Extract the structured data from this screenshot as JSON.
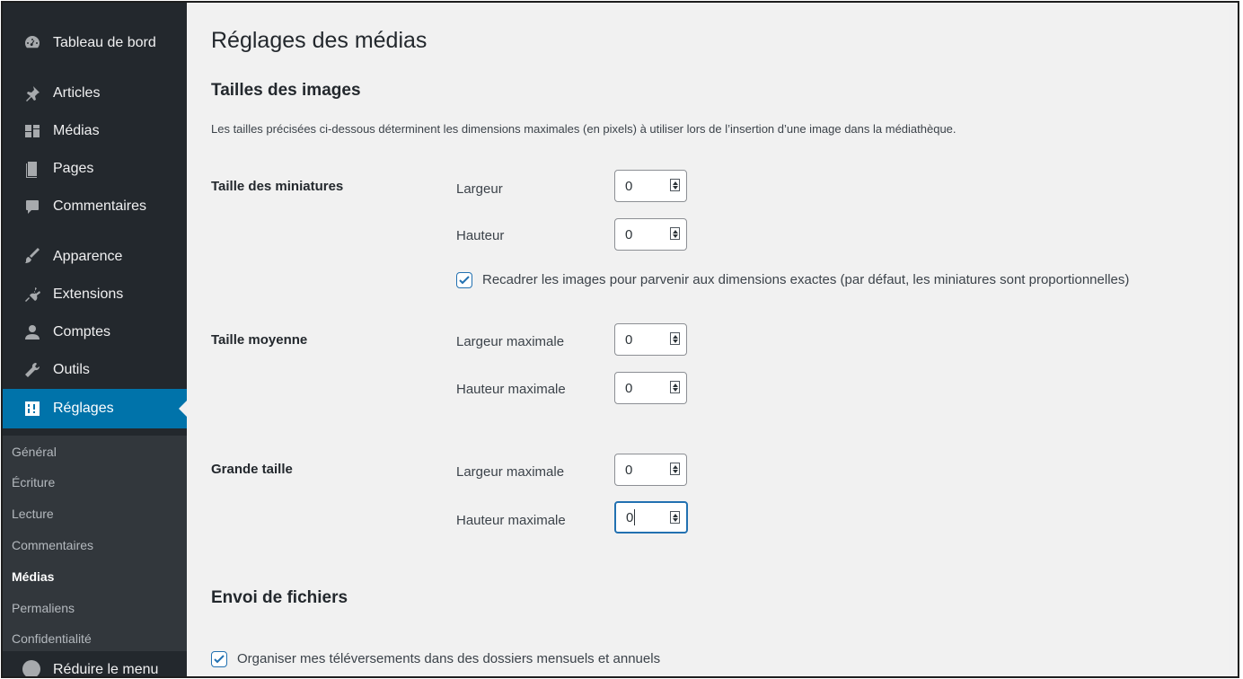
{
  "sidebar": {
    "items": [
      {
        "label": "Tableau de bord",
        "icon": "dashboard-icon"
      },
      {
        "label": "Articles",
        "icon": "pin-icon"
      },
      {
        "label": "Médias",
        "icon": "media-icon"
      },
      {
        "label": "Pages",
        "icon": "page-icon"
      },
      {
        "label": "Commentaires",
        "icon": "comment-icon"
      },
      {
        "label": "Apparence",
        "icon": "brush-icon"
      },
      {
        "label": "Extensions",
        "icon": "plugin-icon"
      },
      {
        "label": "Comptes",
        "icon": "user-icon"
      },
      {
        "label": "Outils",
        "icon": "wrench-icon"
      },
      {
        "label": "Réglages",
        "icon": "settings-icon"
      }
    ],
    "submenu": [
      "Général",
      "Écriture",
      "Lecture",
      "Commentaires",
      "Médias",
      "Permaliens",
      "Confidentialité"
    ],
    "partial_label": "Réduire le menu"
  },
  "main": {
    "title": "Réglages des médias",
    "images_section": "Tailles des images",
    "description": "Les tailles précisées ci-dessous déterminent les dimensions maximales (en pixels) à utiliser lors de l’insertion d’une image dans la médiathèque.",
    "thumbnail": {
      "label": "Taille des miniatures",
      "width_label": "Largeur",
      "width_value": "0",
      "height_label": "Hauteur",
      "height_value": "0",
      "crop_label": "Recadrer les images pour parvenir aux dimensions exactes (par défaut, les miniatures sont proportionnelles)",
      "crop_checked": true
    },
    "medium": {
      "label": "Taille moyenne",
      "width_label": "Largeur maximale",
      "width_value": "0",
      "height_label": "Hauteur maximale",
      "height_value": "0"
    },
    "large": {
      "label": "Grande taille",
      "width_label": "Largeur maximale",
      "width_value": "0",
      "height_label": "Hauteur maximale",
      "height_value": "0"
    },
    "uploads_section": "Envoi de fichiers",
    "uploads_label": "Organiser mes téléversements dans des dossiers mensuels et annuels",
    "uploads_checked": true
  },
  "colors": {
    "sidebar_bg": "#23282d",
    "active_bg": "#0073aa",
    "accent": "#2271b1",
    "content_bg": "#f1f1f1"
  }
}
